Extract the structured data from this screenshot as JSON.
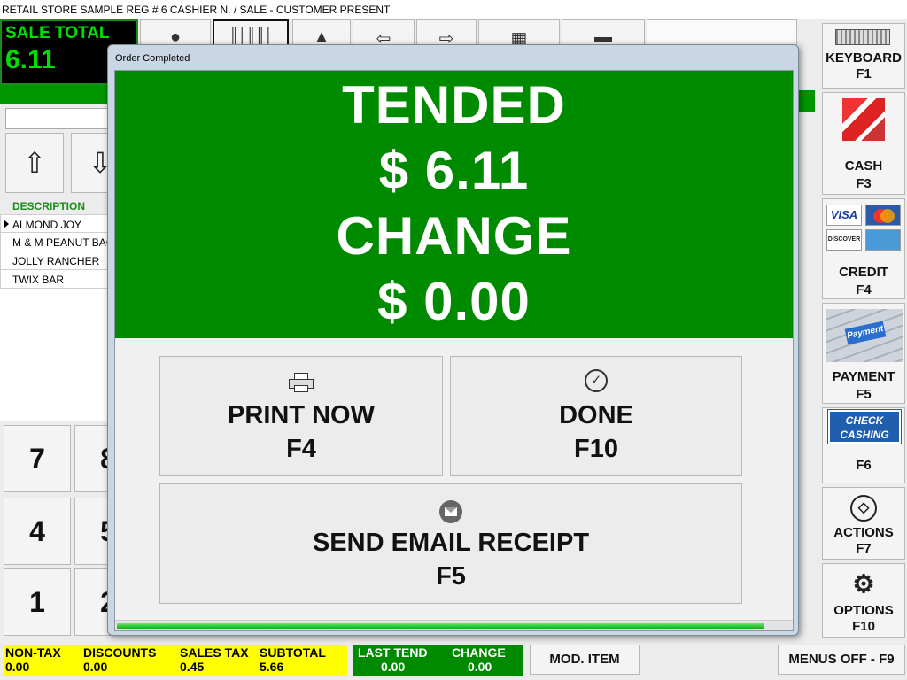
{
  "titlebar": {
    "text": "RETAIL STORE SAMPLE REG # 6 CASHIER N. /  SALE - CUSTOMER PRESENT"
  },
  "sale_total": {
    "label": "SALE TOTAL",
    "value": "6.11"
  },
  "items": {
    "header": "DESCRIPTION",
    "rows": [
      "ALMOND JOY",
      "M & M PEANUT BAG",
      "JOLLY RANCHER",
      "TWIX BAR"
    ]
  },
  "keypad": {
    "keys": [
      "7",
      "8",
      "4",
      "5",
      "1",
      "2"
    ]
  },
  "sidebar": {
    "keyboard": {
      "label": "KEYBOARD",
      "key": "F1",
      "icon": "keyboard-icon"
    },
    "cash": {
      "label": "CASH",
      "key": "F3",
      "icon": "cash-icon"
    },
    "credit": {
      "label": "CREDIT",
      "key": "F4",
      "icon": "credit-cards-icon",
      "card_visa": "VISA",
      "card_discover": "DISCOVER"
    },
    "payment": {
      "label": "PAYMENT",
      "key": "F5",
      "icon": "payment-key-icon",
      "key_text": "Payment"
    },
    "check": {
      "key": "F6",
      "icon": "check-cashing-icon",
      "check_line1": "CHECK",
      "check_line2": "CASHING"
    },
    "actions": {
      "label": "ACTIONS",
      "key": "F7",
      "icon": "actions-icon"
    },
    "options": {
      "label": "OPTIONS",
      "key": "F10",
      "icon": "gear-icon"
    }
  },
  "bottom": {
    "non_tax_label": "NON-TAX",
    "non_tax_value": "0.00",
    "discounts_label": "DISCOUNTS",
    "discounts_value": "0.00",
    "sales_tax_label": "SALES TAX",
    "sales_tax_value": "0.45",
    "subtotal_label": "SUBTOTAL",
    "subtotal_value": "5.66",
    "last_tend_label": "LAST TEND",
    "last_tend_value": "0.00",
    "change_label": "CHANGE",
    "change_value": "0.00",
    "mod_item": "MOD. ITEM",
    "menus_off": "MENUS OFF - F9"
  },
  "dialog": {
    "title": "Order Completed",
    "tended_label": "TENDED",
    "tended_value": "$ 6.11",
    "change_label": "CHANGE",
    "change_value": "$ 0.00",
    "print": {
      "label": "PRINT NOW",
      "key": "F4",
      "icon": "printer-icon"
    },
    "done": {
      "label": "DONE",
      "key": "F10",
      "icon": "checkmark-icon"
    },
    "email": {
      "label": "SEND EMAIL RECEIPT",
      "key": "F5",
      "icon": "mail-icon"
    },
    "progress": 0.96
  },
  "colors": {
    "accent_green": "#008a00",
    "total_green": "#00e000",
    "totals_yellow": "#ffff00"
  }
}
